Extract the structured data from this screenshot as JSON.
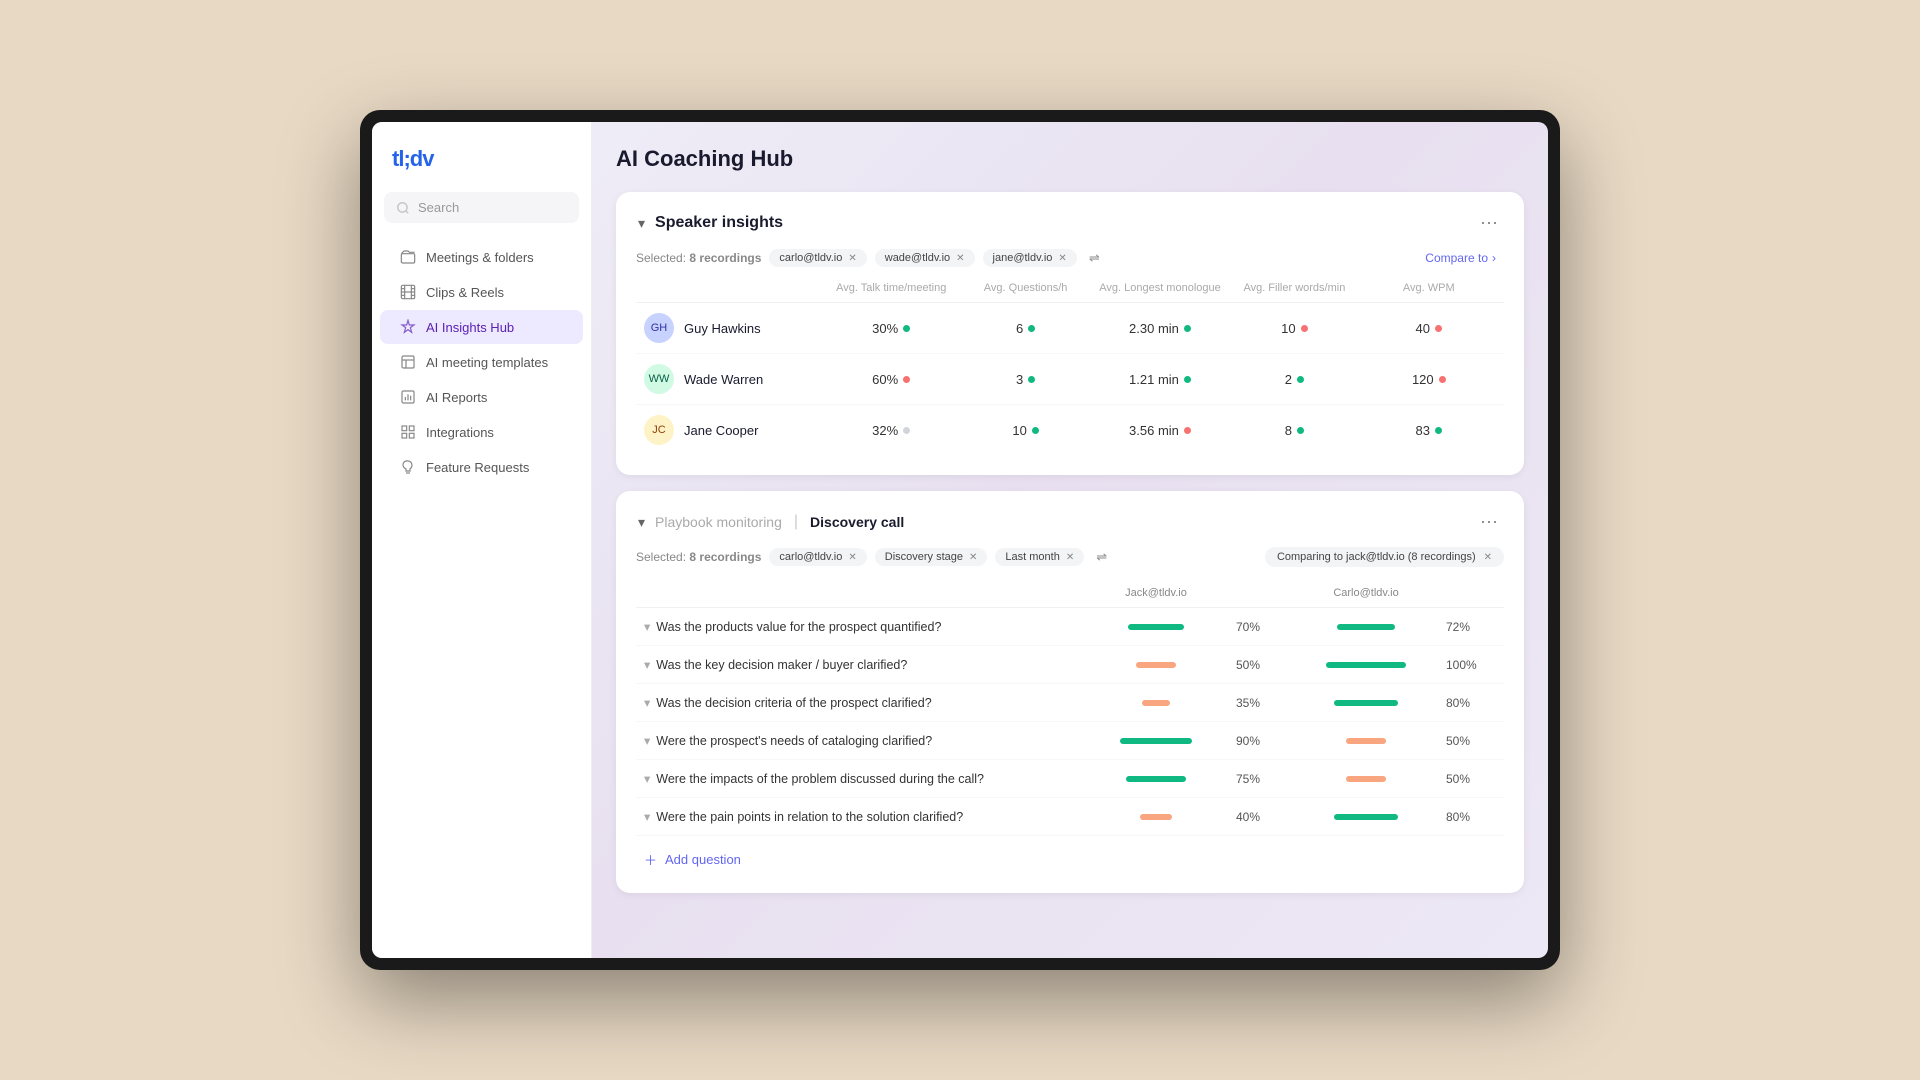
{
  "app": {
    "logo": "tl;dv",
    "title": "AI Coaching Hub"
  },
  "sidebar": {
    "search_placeholder": "Search",
    "nav_items": [
      {
        "id": "meetings",
        "label": "Meetings & folders",
        "icon": "folder"
      },
      {
        "id": "clips",
        "label": "Clips & Reels",
        "icon": "film"
      },
      {
        "id": "ai-insights",
        "label": "AI Insights Hub",
        "icon": "sparkle",
        "active": true
      },
      {
        "id": "ai-templates",
        "label": "AI meeting templates",
        "icon": "template"
      },
      {
        "id": "ai-reports",
        "label": "AI Reports",
        "icon": "reports"
      },
      {
        "id": "integrations",
        "label": "Integrations",
        "icon": "grid"
      },
      {
        "id": "feature-requests",
        "label": "Feature Requests",
        "icon": "lightbulb"
      }
    ]
  },
  "speaker_insights": {
    "section_title": "Speaker insights",
    "selected_label": "Selected:",
    "selected_count": "8 recordings",
    "tags": [
      {
        "id": "carlo",
        "label": "carlo@tldv.io"
      },
      {
        "id": "wade",
        "label": "wade@tldv.io"
      },
      {
        "id": "jane",
        "label": "jane@tldv.io"
      }
    ],
    "compare_btn": "Compare to",
    "columns": [
      "",
      "Avg. Talk time/meeting",
      "Avg. Questions/h",
      "Avg. Longest monologue",
      "Avg. Filler words/min",
      "Avg. WPM"
    ],
    "speakers": [
      {
        "name": "Guy Hawkins",
        "avatar_initials": "GH",
        "talk_time": "30%",
        "talk_dot": "green",
        "questions": "6",
        "questions_dot": "green",
        "monologue": "2.30 min",
        "monologue_dot": "green",
        "filler": "10",
        "filler_dot": "red",
        "wpm": "40",
        "wpm_dot": "red"
      },
      {
        "name": "Wade Warren",
        "avatar_initials": "WW",
        "talk_time": "60%",
        "talk_dot": "red",
        "questions": "3",
        "questions_dot": "green",
        "monologue": "1.21 min",
        "monologue_dot": "green",
        "filler": "2",
        "filler_dot": "green",
        "wpm": "120",
        "wpm_dot": "red"
      },
      {
        "name": "Jane Cooper",
        "avatar_initials": "JC",
        "talk_time": "32%",
        "talk_dot": "gray",
        "questions": "10",
        "questions_dot": "green",
        "monologue": "3.56 min",
        "monologue_dot": "red",
        "filler": "8",
        "filler_dot": "green",
        "wpm": "83",
        "wpm_dot": "green"
      }
    ]
  },
  "playbook": {
    "section_subtitle": "Playbook monitoring",
    "section_name": "Discovery call",
    "selected_label": "Selected:",
    "selected_count": "8 recordings",
    "tags": [
      {
        "id": "carlo2",
        "label": "carlo@tldv.io"
      },
      {
        "id": "discovery",
        "label": "Discovery stage"
      },
      {
        "id": "lastmonth",
        "label": "Last month"
      }
    ],
    "compare_badge": "Comparing to jack@tldv.io (8 recordings)",
    "col_jack": "Jack@tldv.io",
    "col_carlo": "Carlo@tldv.io",
    "questions": [
      {
        "text": "Was the products value for the prospect quantified?",
        "jack_pct": 70,
        "jack_color": "green",
        "jack_label": "70%",
        "carlo_pct": 72,
        "carlo_color": "green",
        "carlo_label": "72%"
      },
      {
        "text": "Was the key decision maker / buyer clarified?",
        "jack_pct": 50,
        "jack_color": "peach",
        "jack_label": "50%",
        "carlo_pct": 100,
        "carlo_color": "green",
        "carlo_label": "100%"
      },
      {
        "text": "Was the decision criteria of the prospect clarified?",
        "jack_pct": 35,
        "jack_color": "peach",
        "jack_label": "35%",
        "carlo_pct": 80,
        "carlo_color": "green",
        "carlo_label": "80%"
      },
      {
        "text": "Were the prospect's needs of cataloging clarified?",
        "jack_pct": 90,
        "jack_color": "green",
        "jack_label": "90%",
        "carlo_pct": 50,
        "carlo_color": "peach",
        "carlo_label": "50%"
      },
      {
        "text": "Were the impacts of the problem discussed during the call?",
        "jack_pct": 75,
        "jack_color": "green",
        "jack_label": "75%",
        "carlo_pct": 50,
        "carlo_color": "peach",
        "carlo_label": "50%"
      },
      {
        "text": "Were the pain points in relation to the solution clarified?",
        "jack_pct": 40,
        "jack_color": "peach",
        "jack_label": "40%",
        "carlo_pct": 80,
        "carlo_color": "green",
        "carlo_label": "80%"
      }
    ],
    "add_question_label": "Add question"
  }
}
